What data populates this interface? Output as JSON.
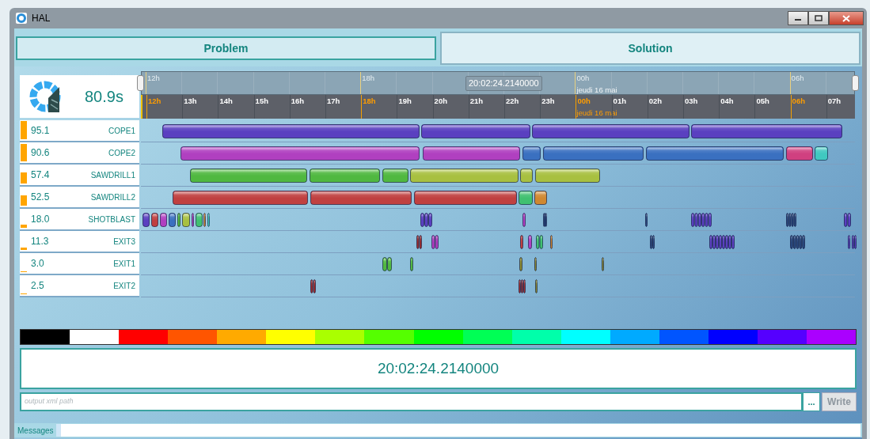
{
  "window": {
    "title": "HAL"
  },
  "tabs": [
    {
      "label": "Problem",
      "selected": false
    },
    {
      "label": "Solution",
      "selected": true
    }
  ],
  "summary": {
    "value": "80.9s"
  },
  "timeline": {
    "cursor_time": "20:02:24.2140000",
    "overview_labels": [
      {
        "label": "12h"
      },
      {
        "label": "18h"
      },
      {
        "label": "00h",
        "date": "jeudi 16 mai"
      },
      {
        "label": "06h"
      }
    ],
    "hours": [
      {
        "label": "12h",
        "major": true
      },
      {
        "label": "13h",
        "major": false
      },
      {
        "label": "14h",
        "major": false
      },
      {
        "label": "15h",
        "major": false
      },
      {
        "label": "16h",
        "major": false
      },
      {
        "label": "17h",
        "major": false
      },
      {
        "label": "18h",
        "major": true
      },
      {
        "label": "19h",
        "major": false
      },
      {
        "label": "20h",
        "major": false
      },
      {
        "label": "21h",
        "major": false
      },
      {
        "label": "22h",
        "major": false
      },
      {
        "label": "23h",
        "major": false
      },
      {
        "label": "00h",
        "major": true,
        "date": "jeudi 16 mai"
      },
      {
        "label": "01h",
        "major": false
      },
      {
        "label": "02h",
        "major": false
      },
      {
        "label": "03h",
        "major": false
      },
      {
        "label": "04h",
        "major": false
      },
      {
        "label": "05h",
        "major": false
      },
      {
        "label": "06h",
        "major": true
      },
      {
        "label": "07h",
        "major": false
      }
    ]
  },
  "resources": [
    {
      "value": "95.1",
      "name": "COPE1"
    },
    {
      "value": "90.6",
      "name": "COPE2"
    },
    {
      "value": "57.4",
      "name": "SAWDRILL1"
    },
    {
      "value": "52.5",
      "name": "SAWDRILL2"
    },
    {
      "value": "18.0",
      "name": "SHOTBLAST"
    },
    {
      "value": "11.3",
      "name": "EXIT3"
    },
    {
      "value": "3.0",
      "name": "EXIT1"
    },
    {
      "value": "2.5",
      "name": "EXIT2"
    }
  ],
  "palette": [
    {
      "color": "#000000"
    },
    {
      "color": "#ffffff"
    },
    {
      "color": "#ff0000"
    },
    {
      "color": "#ff5500"
    },
    {
      "color": "#ffaa00"
    },
    {
      "color": "#ffff00"
    },
    {
      "color": "#aaff00"
    },
    {
      "color": "#55ff00"
    },
    {
      "color": "#00ff00"
    },
    {
      "color": "#00ff55"
    },
    {
      "color": "#00ffaa"
    },
    {
      "color": "#00ffff"
    },
    {
      "color": "#00aaff"
    },
    {
      "color": "#0055ff"
    },
    {
      "color": "#0000ff"
    },
    {
      "color": "#5500ff"
    },
    {
      "color": "#aa00ff"
    }
  ],
  "time_display": "20:02:24.2140000",
  "output": {
    "placeholder": "output xml path",
    "browse_label": "...",
    "write_button": {
      "label": "Write",
      "disabled": true
    }
  },
  "messages": {
    "label": "Messages"
  }
}
